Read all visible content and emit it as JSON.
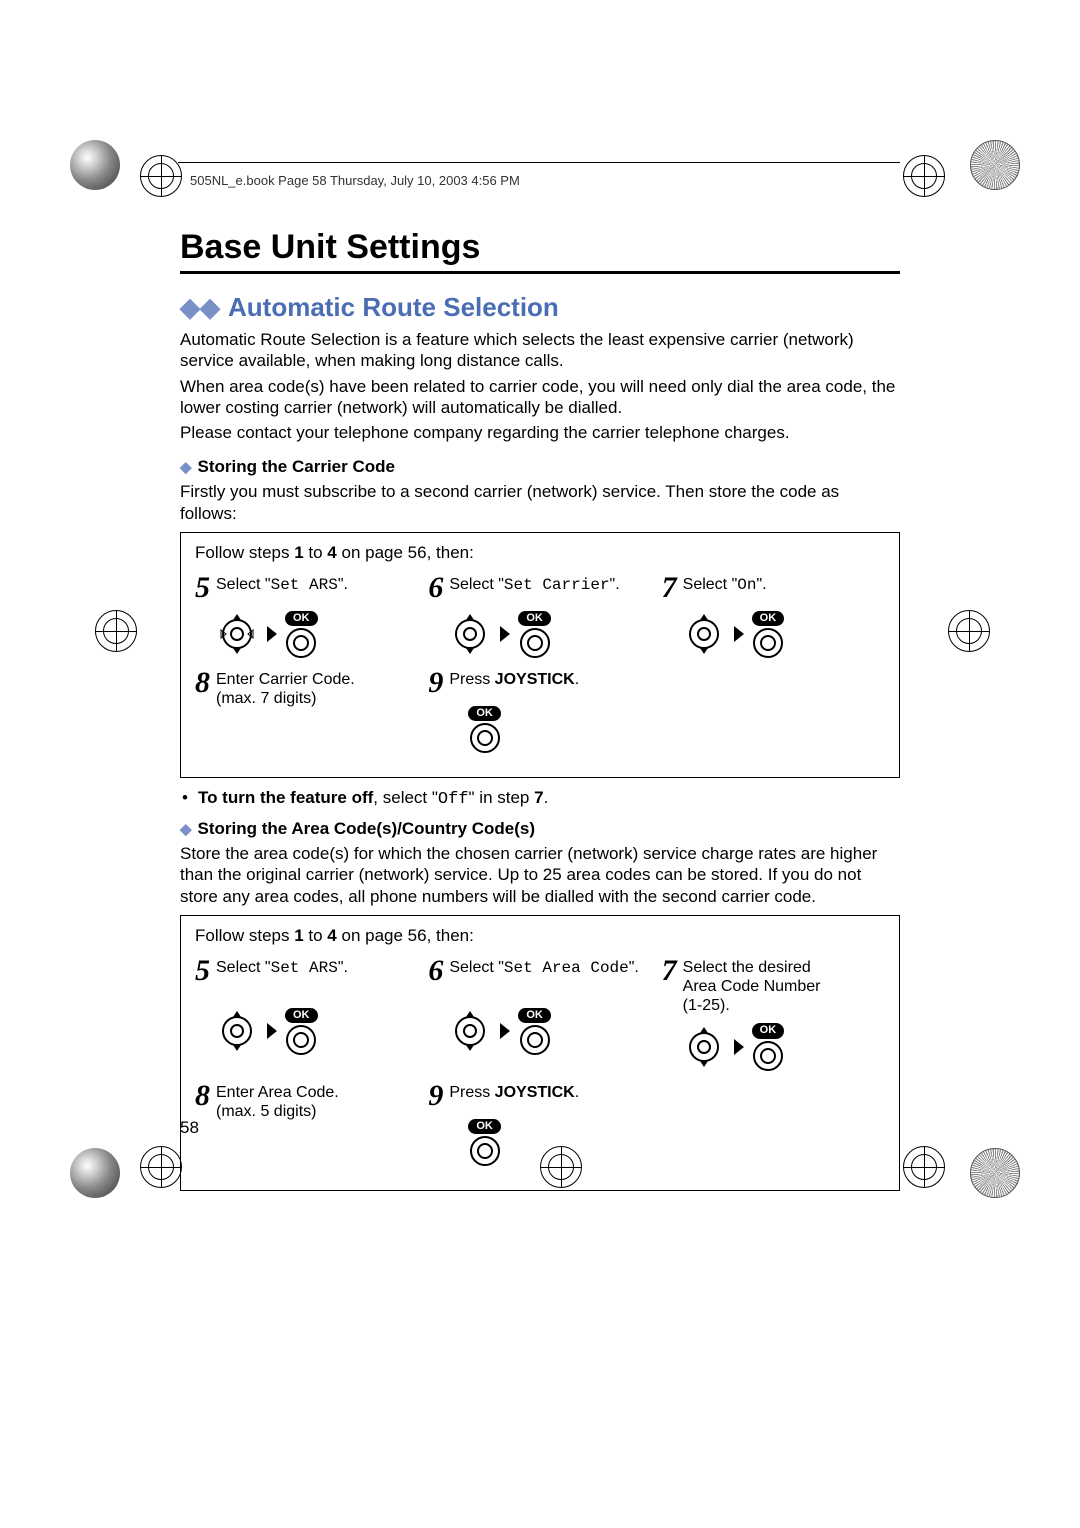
{
  "header_line": "505NL_e.book  Page 58  Thursday, July 10, 2003  4:56 PM",
  "title": "Base Unit Settings",
  "section_title": "Automatic Route Selection",
  "intro": {
    "p1": "Automatic Route Selection is a feature which selects the least expensive carrier (network) service available, when making long distance calls.",
    "p2": "When area code(s) have been related to carrier code, you will need only dial the area code, the lower costing carrier (network) will automatically be dialled.",
    "p3": "Please contact your telephone company regarding the carrier telephone charges."
  },
  "sub1": {
    "heading": "Storing the Carrier Code",
    "lead": "Firstly you must subscribe to a second carrier (network) service. Then store the code as follows:",
    "follow_prefix": "Follow steps ",
    "follow_b1": "1",
    "follow_mid": " to ",
    "follow_b2": "4",
    "follow_suffix": " on page 56, then:",
    "steps": {
      "s5_num": "5",
      "s5_pre": "Select \"",
      "s5_mono": "Set ARS",
      "s5_post": "\".",
      "s6_num": "6",
      "s6_pre": "Select \"",
      "s6_mono": "Set Carrier",
      "s6_post": "\".",
      "s7_num": "7",
      "s7_pre": "Select \"",
      "s7_mono": "On",
      "s7_post": "\".",
      "s8_num": "8",
      "s8_text_l1": "Enter Carrier Code.",
      "s8_text_l2": "(max. 7 digits)",
      "s9_num": "9",
      "s9_pre": "Press ",
      "s9_bold": "JOYSTICK",
      "s9_post": "."
    },
    "note_pre": "To turn the feature off",
    "note_mid": ", select \"",
    "note_mono": "Off",
    "note_post": "\" in step ",
    "note_step": "7",
    "note_end": "."
  },
  "sub2": {
    "heading": "Storing the Area Code(s)/Country Code(s)",
    "lead": "Store the area code(s) for which the chosen carrier (network) service charge rates are higher than the original carrier (network) service. Up to 25 area codes can be stored. If you do not store any area codes, all phone numbers will be dialled with the second carrier code.",
    "follow_prefix": "Follow steps ",
    "follow_b1": "1",
    "follow_mid": " to ",
    "follow_b2": "4",
    "follow_suffix": " on page 56, then:",
    "steps": {
      "s5_num": "5",
      "s5_pre": "Select \"",
      "s5_mono": "Set ARS",
      "s5_post": "\".",
      "s6_num": "6",
      "s6_pre": "Select \"",
      "s6_mono": "Set Area Code",
      "s6_post": "\".",
      "s7_num": "7",
      "s7_l1": "Select the desired",
      "s7_l2": "Area Code Number",
      "s7_l3": "(1-25).",
      "s8_num": "8",
      "s8_text_l1": "Enter Area Code.",
      "s8_text_l2": "(max. 5 digits)",
      "s9_num": "9",
      "s9_pre": "Press ",
      "s9_bold": "JOYSTICK",
      "s9_post": "."
    }
  },
  "page_number": "58",
  "ok_label": "OK"
}
